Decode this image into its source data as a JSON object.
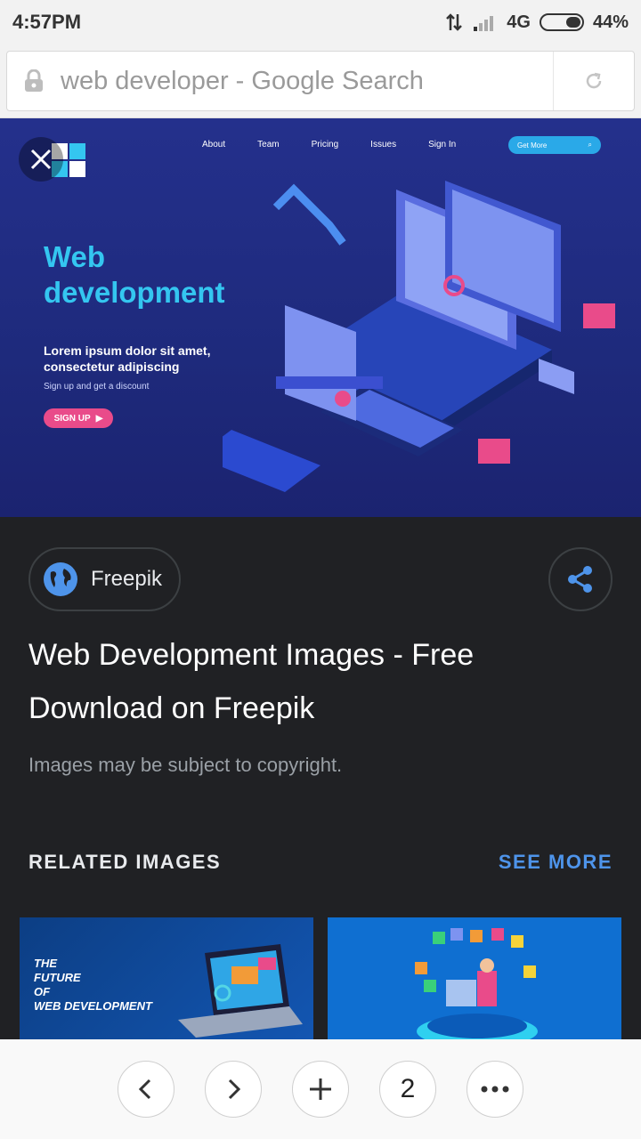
{
  "status": {
    "time": "4:57PM",
    "network": "4G",
    "battery": "44%",
    "battery_level": 0.44
  },
  "browser": {
    "url_text": "web developer - Google Search"
  },
  "hero": {
    "logo_text": "LOGO",
    "nav": [
      "About",
      "Team",
      "Pricing",
      "Issues",
      "Sign In"
    ],
    "get_more": "Get More",
    "title_line1": "Web",
    "title_line2": "development",
    "sub_line1": "Lorem ipsum dolor sit amet,",
    "sub_line2": "consectetur adipiscing",
    "small": "Sign up and get a discount",
    "signup": "SIGN UP"
  },
  "result": {
    "source": "Freepik",
    "title": "Web Development Images - Free Download on Freepik",
    "copyright": "Images may be subject to copyright."
  },
  "related": {
    "header": "RELATED IMAGES",
    "see_more": "SEE MORE",
    "thumb1_line1": "THE",
    "thumb1_line2": "FUTURE",
    "thumb1_line3": "OF",
    "thumb1_line4": "WEB DEVELOPMENT"
  },
  "bottom_nav": {
    "tab_count": "2"
  },
  "colors": {
    "accent": "#4e94ea",
    "background": "#202124",
    "hero_title": "#34c6f0",
    "signup": "#e94b8a"
  }
}
